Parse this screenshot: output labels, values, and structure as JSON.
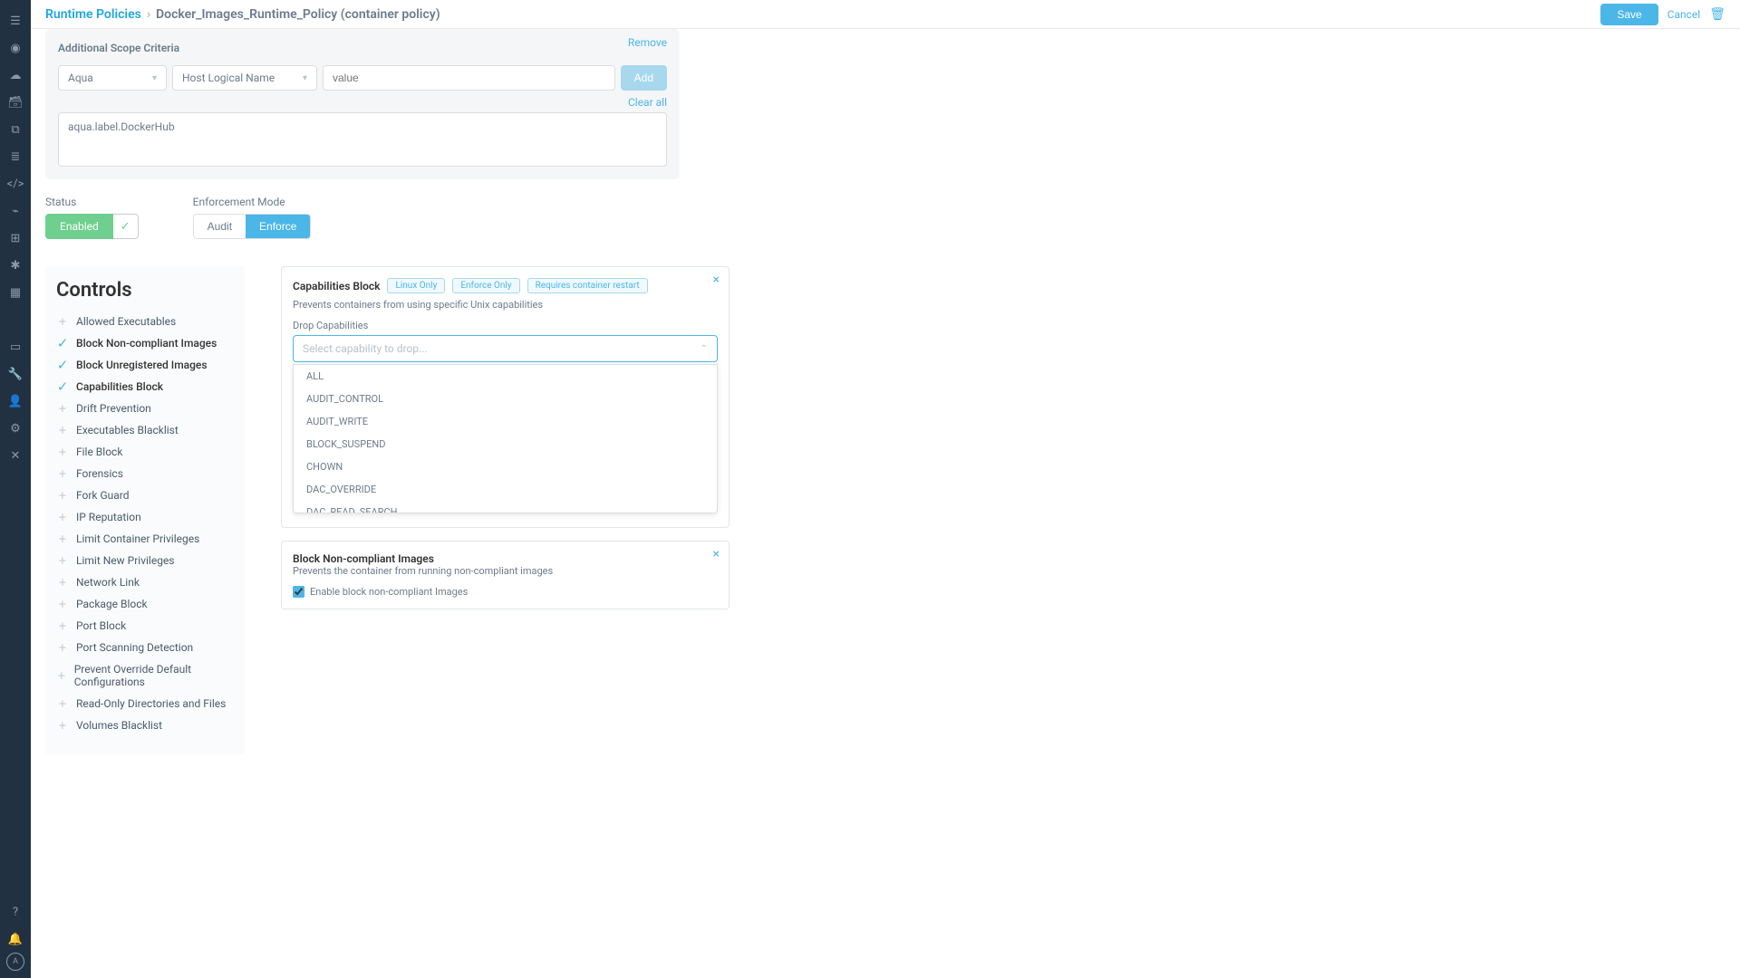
{
  "breadcrumb": {
    "parent": "Runtime Policies",
    "current": "Docker_Images_Runtime_Policy (container policy)"
  },
  "top_actions": {
    "save": "Save",
    "cancel": "Cancel"
  },
  "scope": {
    "title": "Additional Scope Criteria",
    "remove": "Remove",
    "selector1": "Aqua",
    "selector2": "Host Logical Name",
    "value_placeholder": "value",
    "add": "Add",
    "clear_all": "Clear all",
    "criteria_text": "aqua.label.DockerHub"
  },
  "status": {
    "label": "Status",
    "enabled": "Enabled"
  },
  "enforcement": {
    "label": "Enforcement Mode",
    "audit": "Audit",
    "enforce": "Enforce"
  },
  "controls": {
    "heading": "Controls",
    "items": [
      {
        "label": "Allowed Executables",
        "checked": false
      },
      {
        "label": "Block Non-compliant Images",
        "checked": true
      },
      {
        "label": "Block Unregistered Images",
        "checked": true
      },
      {
        "label": "Capabilities Block",
        "checked": true
      },
      {
        "label": "Drift Prevention",
        "checked": false
      },
      {
        "label": "Executables Blacklist",
        "checked": false
      },
      {
        "label": "File Block",
        "checked": false
      },
      {
        "label": "Forensics",
        "checked": false
      },
      {
        "label": "Fork Guard",
        "checked": false
      },
      {
        "label": "IP Reputation",
        "checked": false
      },
      {
        "label": "Limit Container Privileges",
        "checked": false
      },
      {
        "label": "Limit New Privileges",
        "checked": false
      },
      {
        "label": "Network Link",
        "checked": false
      },
      {
        "label": "Package Block",
        "checked": false
      },
      {
        "label": "Port Block",
        "checked": false
      },
      {
        "label": "Port Scanning Detection",
        "checked": false
      },
      {
        "label": "Prevent Override Default Configurations",
        "checked": false
      },
      {
        "label": "Read-Only Directories and Files",
        "checked": false
      },
      {
        "label": "Volumes Blacklist",
        "checked": false
      }
    ]
  },
  "capabilities_card": {
    "title": "Capabilities Block",
    "badges": [
      "Linux Only",
      "Enforce Only",
      "Requires container restart"
    ],
    "desc": "Prevents containers from using specific Unix capabilities",
    "field_label": "Drop Capabilities",
    "placeholder": "Select capability to drop...",
    "options": [
      "ALL",
      "AUDIT_CONTROL",
      "AUDIT_WRITE",
      "BLOCK_SUSPEND",
      "CHOWN",
      "DAC_OVERRIDE",
      "DAC_READ_SEARCH"
    ]
  },
  "block_noncompliant_card": {
    "title": "Block Non-compliant Images",
    "desc": "Prevents the container from running non-compliant images",
    "checkbox_label": "Enable block non-compliant Images"
  }
}
